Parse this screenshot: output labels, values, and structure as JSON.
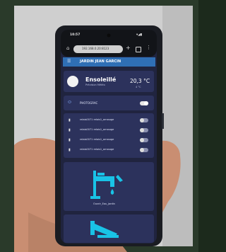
{
  "colors": {
    "background_wall": "#2a3a2a",
    "phone_body": "#1a1c22",
    "app_bg": "#20243f",
    "card": "#2c325c",
    "header_blue": "#2f6fb5",
    "accent_cyan": "#19c3e6",
    "skin": "#c98e72"
  },
  "status_bar": {
    "time": "10:57",
    "indicators": "▾◢▮"
  },
  "browser": {
    "url": "192.168.0.20:8123"
  },
  "header": {
    "title": "JARDIN JEAN GARCIN"
  },
  "weather": {
    "condition": "Ensoleillé",
    "subtitle": "Prévision Météo",
    "temperature": "20,3 °C",
    "subtitle2": "4 °C"
  },
  "photo": {
    "label": "PHOTOGRAC"
  },
  "zones": [
    {
      "label": "relais0071 relais1_arrosage"
    },
    {
      "label": "relais0071 relais1_arrosage"
    },
    {
      "label": "relais0071 relais1_arrosage"
    },
    {
      "label": "relais0071 relais1_arrosage"
    }
  ],
  "water_tile": {
    "label": "Ouvrir_Eau_jardin"
  },
  "icons": [
    "home-icon",
    "plus-icon",
    "tabs-icon",
    "menu-icon",
    "hamburger-icon",
    "camera-icon",
    "sprinkler-icon",
    "faucet-icon",
    "hand-faucet-icon"
  ]
}
